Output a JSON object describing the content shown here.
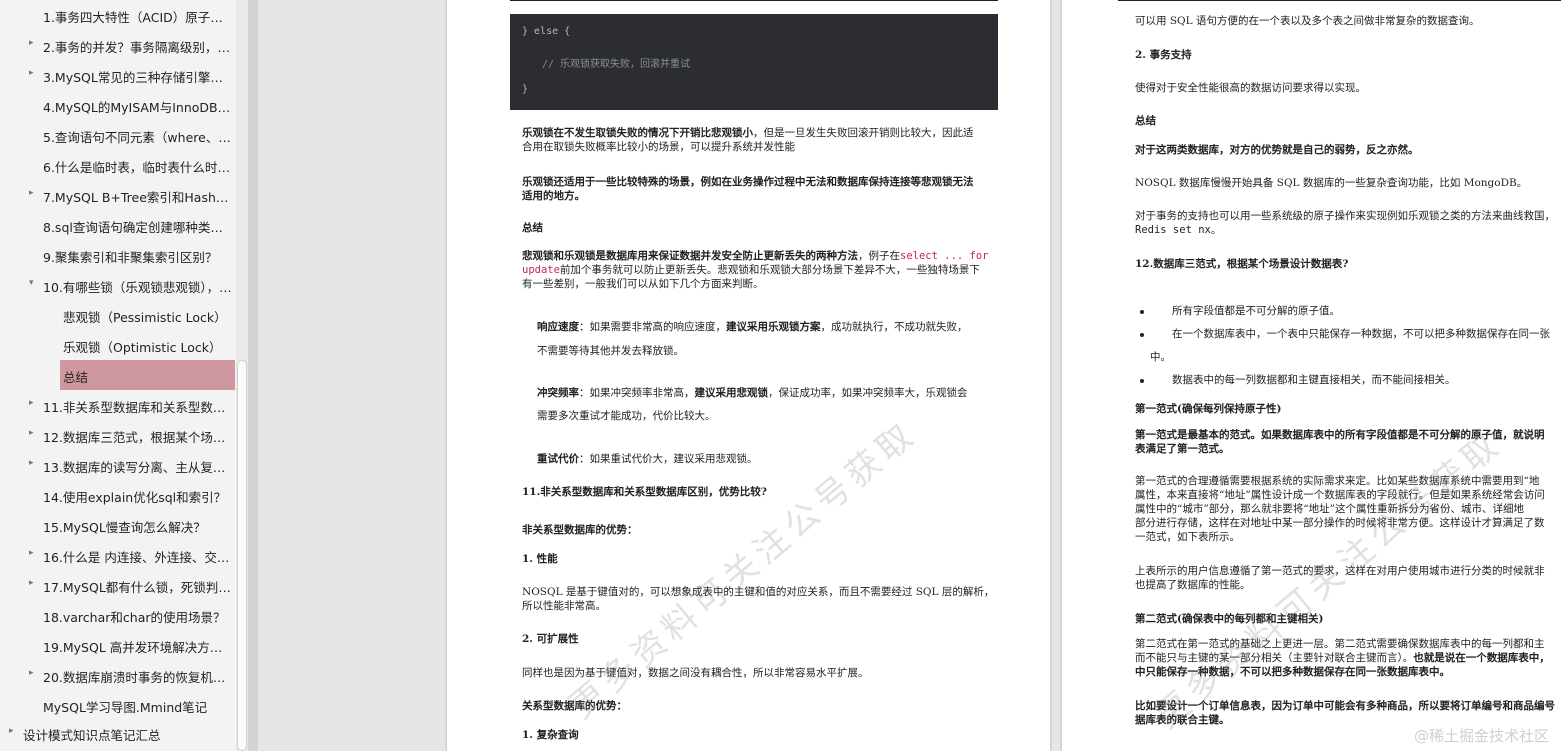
{
  "sidebar": {
    "items": [
      {
        "label": "1.事务四大特性（ACID）原子性...",
        "arrow": ""
      },
      {
        "label": "2.事务的并发？事务隔离级别，每...",
        "arrow": "▸"
      },
      {
        "label": "3.MySQL常见的三种存储引擎（I...",
        "arrow": "▸"
      },
      {
        "label": "4.MySQL的MyISAM与InnoDB两...",
        "arrow": ""
      },
      {
        "label": "5.查询语句不同元素（where、jio...",
        "arrow": ""
      },
      {
        "label": "6.什么是临时表，临时表什么时候...",
        "arrow": ""
      },
      {
        "label": "7.MySQL B+Tree索引和Hash索...",
        "arrow": "▸"
      },
      {
        "label": "8.sql查询语句确定创建哪种类型...",
        "arrow": ""
      },
      {
        "label": "9.聚集索引和非聚集索引区别？",
        "arrow": ""
      },
      {
        "label": "10.有哪些锁（乐观锁悲观锁），s...",
        "arrow": "▾"
      },
      {
        "label": "悲观锁（Pessimistic Lock）",
        "arrow": ""
      },
      {
        "label": "乐观锁（Optimistic Lock）",
        "arrow": ""
      },
      {
        "label": "总结",
        "arrow": ""
      },
      {
        "label": "11.非关系型数据库和关系型数据...",
        "arrow": "▸"
      },
      {
        "label": "12.数据库三范式，根据某个场景...",
        "arrow": "▸"
      },
      {
        "label": "13.数据库的读写分离、主从复制...",
        "arrow": "▸"
      },
      {
        "label": "14.使用explain优化sql和索引？",
        "arrow": ""
      },
      {
        "label": "15.MySQL慢查询怎么解决？",
        "arrow": ""
      },
      {
        "label": "16.什么是 内连接、外连接、交叉...",
        "arrow": "▸"
      },
      {
        "label": "17.MySQL都有什么锁，死锁判定...",
        "arrow": "▸"
      },
      {
        "label": "18.varchar和char的使用场景？",
        "arrow": ""
      },
      {
        "label": "19.MySQL 高并发环境解决方案？",
        "arrow": ""
      },
      {
        "label": "20.数据库崩溃时事务的恢复机制...",
        "arrow": "▸"
      },
      {
        "label": "MySQL学习导图.Mmind笔记",
        "arrow": ""
      },
      {
        "label": "设计模式知识点笔记汇总",
        "arrow": "▸"
      }
    ]
  },
  "page1": {
    "code": {
      "line1": "} else {",
      "line2": "// 乐观锁获取失败，回滚并重试",
      "line3": "}"
    },
    "p1_bold": "乐观锁在不发生取锁失败的情况下开销比悲观锁小",
    "p1_rest": "，但是一旦发生失败回滚开销则比较大，因此适",
    "p1_line2": "合用在取锁失败概率比较小的场景，可以提升系统并发性能",
    "p2_line1": "乐观锁还适用于一些比较特殊的场景，例如在业务操作过程中无法和数据库保持连接等悲观锁无法",
    "p2_line2": "适用的地方。",
    "h_summary": "总结",
    "p3_bold": "悲观锁和乐观锁是数据库用来保证数据并发安全防止更新丢失的两种方法",
    "p3_mid": "，例子在",
    "p3_code1": "select ... for",
    "p3_code2": "update",
    "p3_line2_rest": "前加个事务就可以防止更新丢失。悲观锁和乐观锁大部分场景下差异不大，一些独特场景下",
    "p3_line3": "有一些差别，一般我们可以从如下几个方面来判断。",
    "resp_label": "响应速度",
    "resp_a": "：如果需要非常高的响应速度，",
    "resp_bold": "建议采用乐观锁方案",
    "resp_b": "，成功就执行，不成功就失败，",
    "resp_line2": "不需要等待其他并发去释放锁。",
    "conf_label": "冲突频率",
    "conf_a": "：如果冲突频率非常高，",
    "conf_bold": "建议采用悲观锁",
    "conf_b": "，保证成功率，如果冲突频率大，乐观锁会",
    "conf_line2": "需要多次重试才能成功，代价比较大。",
    "retry_label": "重试代价",
    "retry_text": "：如果重试代价大，建议采用悲观锁。",
    "h11": "11.非关系型数据库和关系型数据库区别，优势比较?",
    "nosql_adv": "非关系型数据库的优势：",
    "perf": "1. 性能",
    "perf_l1": "NOSQL 是基于键值对的，可以想象成表中的主键和值的对应关系，而且不需要经过 SQL 层的解析，",
    "perf_l2": "所以性能非常高。",
    "scale": "2. 可扩展性",
    "scale_l1": "同样也是因为基于键值对，数据之间没有耦合性，所以非常容易水平扩展。",
    "rel_adv": "关系型数据库的优势：",
    "complex": "1. 复杂查询"
  },
  "page2": {
    "l_top": "可以用 SQL 语句方便的在一个表以及多个表之间做非常复杂的数据查询。",
    "tx": "2. 事务支持",
    "tx_l1": "使得对于安全性能很高的数据访问要求得以实现。",
    "summary": "总结",
    "sum_bold": "对于这两类数据库，对方的优势就是自己的弱势，反之亦然。",
    "nosql_l": "NOSQL 数据库慢慢开始具备 SQL 数据库的一些复杂查询功能，比如 MongoDB。",
    "tx_l2": "对于事务的支持也可以用一些系统级的原子操作来实现例如乐观锁之类的方法来曲线救国，",
    "tx_l3": "Redis set nx。",
    "h12": "12.数据库三范式，根据某个场景设计数据表?",
    "b1": "所有字段值都是不可分解的原子值。",
    "b2": "在一个数据库表中，一个表中只能保存一种数据，不可以把多种数据保存在同一张",
    "b2_cont": "中。",
    "b3": "数据表中的每一列数据都和主键直接相关，而不能间接相关。",
    "nf1_h": "第一范式(确保每列保持原子性)",
    "nf1_b1": "第一范式是最基本的范式。如果数据库表中的所有字段值都是不可分解的原子值，就说明",
    "nf1_b2": "表满足了第一范式。",
    "nf1_p1": "第一范式的合理遵循需要根据系统的实际需求来定。比如某些数据库系统中需要用到“地",
    "nf1_p2": "属性，本来直接将“地址”属性设计成一个数据库表的字段就行。但是如果系统经常会访问",
    "nf1_p3": "属性中的“城市”部分，那么就非要将“地址”这个属性重新拆分为省份、城市、详细地",
    "nf1_p4": "部分进行存储，这样在对地址中某一部分操作的时候将非常方便。这样设计才算满足了数",
    "nf1_p5": "一范式，如下表所示。",
    "nf1_q1": "上表所示的用户信息遵循了第一范式的要求，这样在对用户使用城市进行分类的时候就非",
    "nf1_q2": "也提高了数据库的性能。",
    "nf2_h": "第二范式(确保表中的每列都和主键相关)",
    "nf2_p1": "第二范式在第一范式的基础之上更进一层。第二范式需要确保数据库表中的每一列都和主",
    "nf2_p2a": "而不能只与主键的某一部分相关（主要针对联合主键而言）。",
    "nf2_p2b": "也就是说在一个数据库表中，",
    "nf2_p3": "中只能保存一种数据，不可以把多种数据保存在同一张数据库表中。",
    "nf2_p4": "比如要设计一个订单信息表，因为订单中可能会有多种商品，所以要将订单编号和商品编号",
    "nf2_p5": "据库表的联合主键。"
  },
  "watermark": {
    "text1": "更多资料可关注公号获取",
    "text2": "更多资料可关注公号获取"
  },
  "credit": "@稀土掘金技术社区",
  "colors": {
    "active_bg": "#cf97a0",
    "code_bg": "#2b2d33",
    "inline_code": "#c7254e"
  }
}
